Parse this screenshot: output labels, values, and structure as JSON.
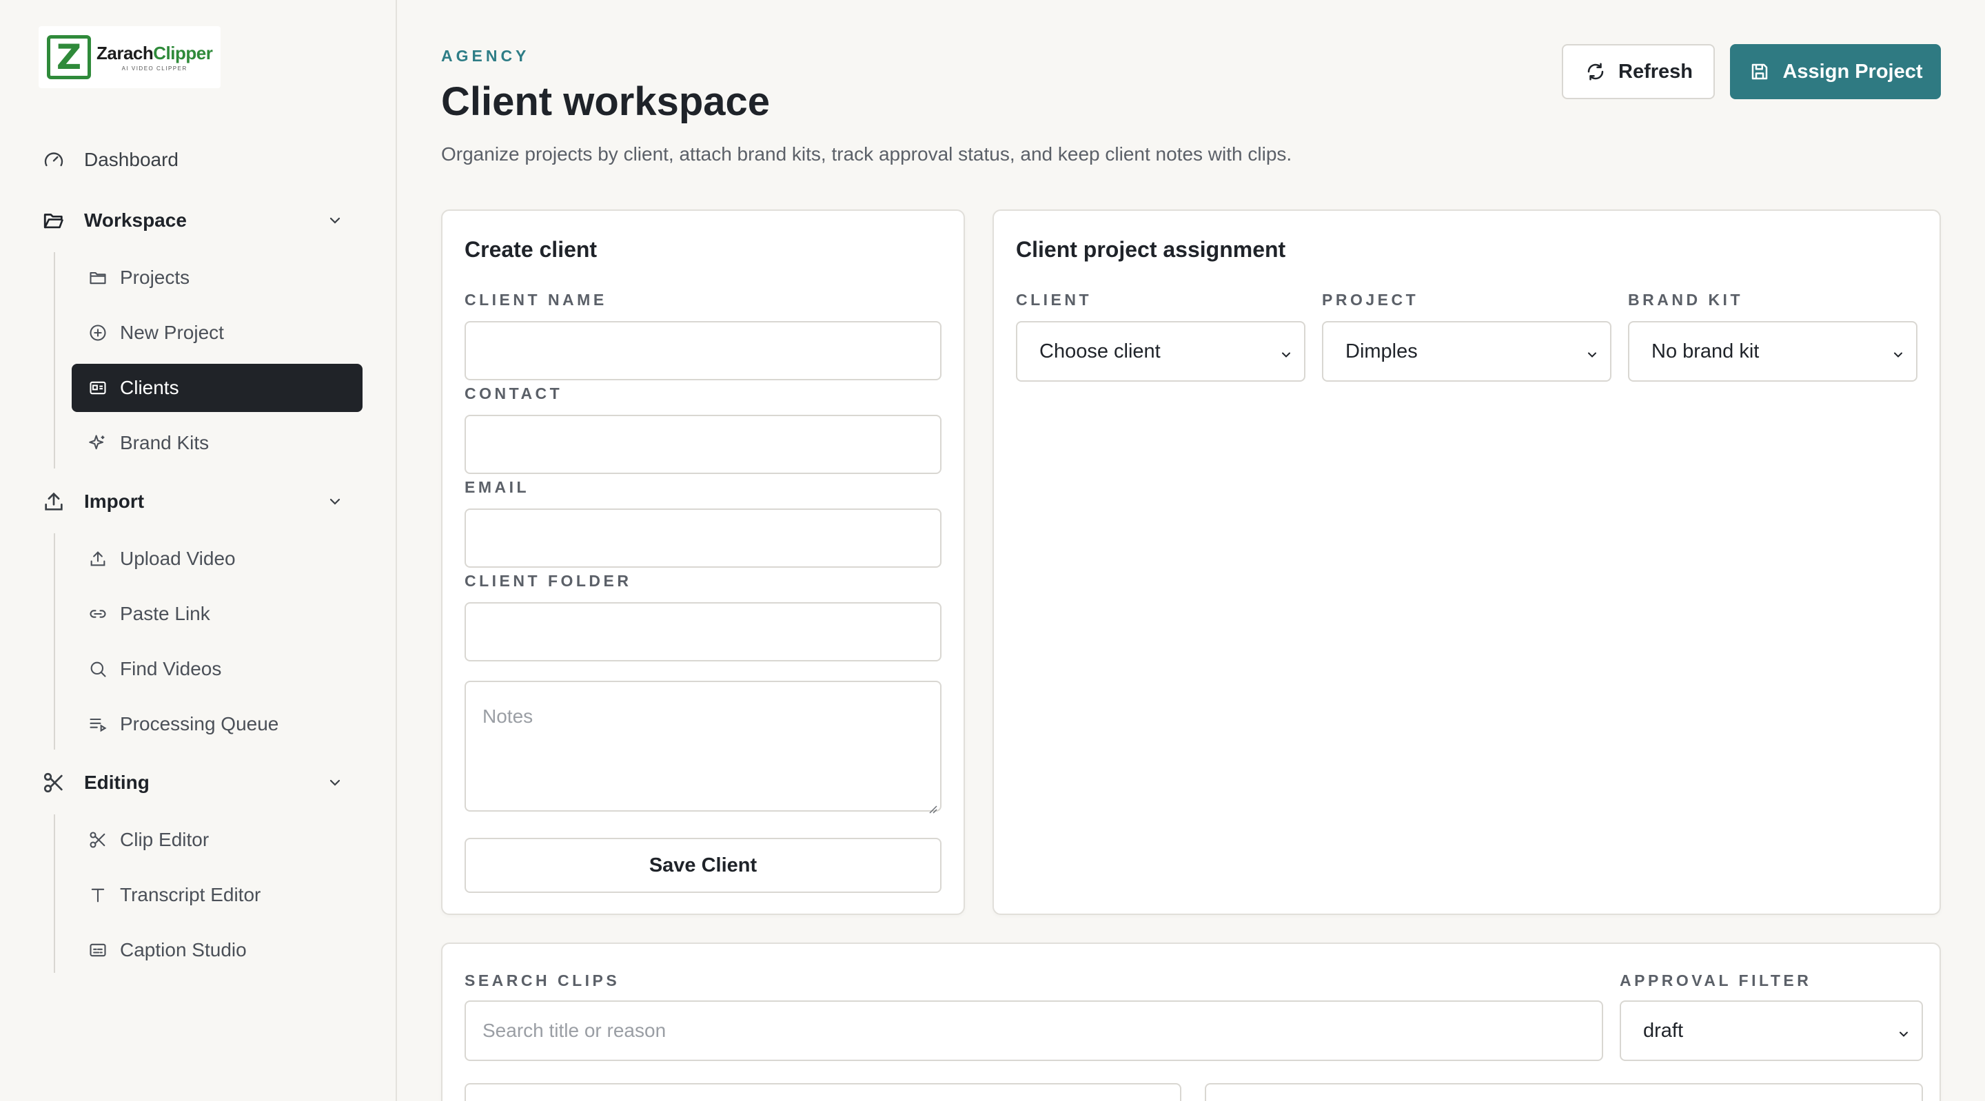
{
  "brand": {
    "logo_letter": "Z",
    "name_part1": "Zarach",
    "name_part2": "Clipper",
    "tagline": "AI VIDEO CLIPPER",
    "accent": "#2f8a3a"
  },
  "sidebar": {
    "dashboard": "Dashboard",
    "sections": [
      {
        "label": "Workspace",
        "icon": "folder-open-icon",
        "items": [
          {
            "label": "Projects",
            "icon": "folder-icon"
          },
          {
            "label": "New Project",
            "icon": "plus-circle-icon"
          },
          {
            "label": "Clients",
            "icon": "id-card-icon",
            "active": true
          },
          {
            "label": "Brand Kits",
            "icon": "sparkles-icon"
          }
        ]
      },
      {
        "label": "Import",
        "icon": "upload-icon",
        "items": [
          {
            "label": "Upload Video",
            "icon": "upload-icon"
          },
          {
            "label": "Paste Link",
            "icon": "link-icon"
          },
          {
            "label": "Find Videos",
            "icon": "search-icon"
          },
          {
            "label": "Processing Queue",
            "icon": "list-play-icon"
          }
        ]
      },
      {
        "label": "Editing",
        "icon": "scissors-icon",
        "items": [
          {
            "label": "Clip Editor",
            "icon": "scissors-icon"
          },
          {
            "label": "Transcript Editor",
            "icon": "text-icon"
          },
          {
            "label": "Caption Studio",
            "icon": "captions-icon"
          }
        ]
      }
    ]
  },
  "header": {
    "eyebrow": "AGENCY",
    "title": "Client workspace",
    "subtitle": "Organize projects by client, attach brand kits, track approval status, and keep client notes with clips.",
    "refresh_label": "Refresh",
    "assign_label": "Assign Project"
  },
  "create_client": {
    "title": "Create client",
    "client_name_label": "CLIENT NAME",
    "client_name_value": "",
    "contact_label": "CONTACT",
    "contact_value": "",
    "email_label": "EMAIL",
    "email_value": "",
    "folder_label": "CLIENT FOLDER",
    "folder_value": "",
    "notes_placeholder": "Notes",
    "save_label": "Save Client"
  },
  "assignment": {
    "title": "Client project assignment",
    "client_label": "CLIENT",
    "client_value": "Choose client",
    "project_label": "PROJECT",
    "project_value": "Dimples",
    "brand_kit_label": "BRAND KIT",
    "brand_kit_value": "No brand kit"
  },
  "clips": {
    "search_label": "SEARCH CLIPS",
    "search_placeholder": "Search title or reason",
    "approval_label": "APPROVAL FILTER",
    "approval_value": "draft"
  },
  "colors": {
    "primary": "#2f7a82",
    "active_nav": "#202328",
    "eyebrow": "#2e7d86"
  }
}
